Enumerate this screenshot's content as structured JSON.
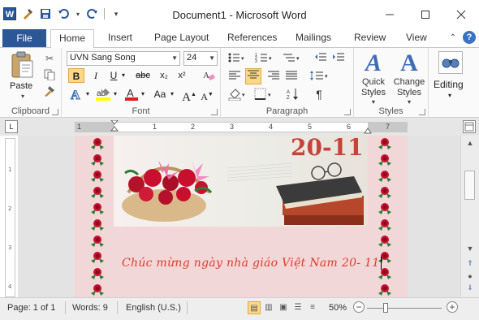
{
  "window": {
    "title": "Document1  -  Microsoft Word",
    "app_icon": "W",
    "qat": [
      "save-icon",
      "undo-icon",
      "redo-icon",
      "customize-icon"
    ]
  },
  "tabs": {
    "file": "File",
    "items": [
      "Home",
      "Insert",
      "Page Layout",
      "References",
      "Mailings",
      "Review",
      "View"
    ],
    "active": "Home"
  },
  "ribbon": {
    "clipboard": {
      "label": "Clipboard",
      "paste": "Paste"
    },
    "font": {
      "label": "Font",
      "font_name": "UVN Sang Song",
      "font_size": "24",
      "bold": "B",
      "italic": "I",
      "underline": "U",
      "strike": "abc",
      "subscript": "x₂",
      "superscript": "x²",
      "grow": "A",
      "shrink": "A",
      "change_case": "Aa",
      "highlight_color": "#ffff00",
      "font_color": "#e02020"
    },
    "paragraph": {
      "label": "Paragraph"
    },
    "styles": {
      "label": "Styles",
      "quick_styles": "Quick Styles",
      "change_styles": "Change Styles"
    },
    "editing": {
      "label": "Editing"
    }
  },
  "ruler": {
    "numbers": [
      "1",
      "1",
      "2",
      "3",
      "4",
      "5",
      "6",
      "7"
    ]
  },
  "document": {
    "card_year": "20-11",
    "greeting": "Chúc mừng ngày nhà giáo Việt Nam 20- 11"
  },
  "status": {
    "page": "Page: 1 of 1",
    "words": "Words: 9",
    "language": "English (U.S.)",
    "zoom": "50%",
    "zoom_fraction": 0.5
  },
  "colors": {
    "accent": "#2b5797",
    "page_bg": "#f1d7d7",
    "greeting_text": "#e23a2c"
  }
}
